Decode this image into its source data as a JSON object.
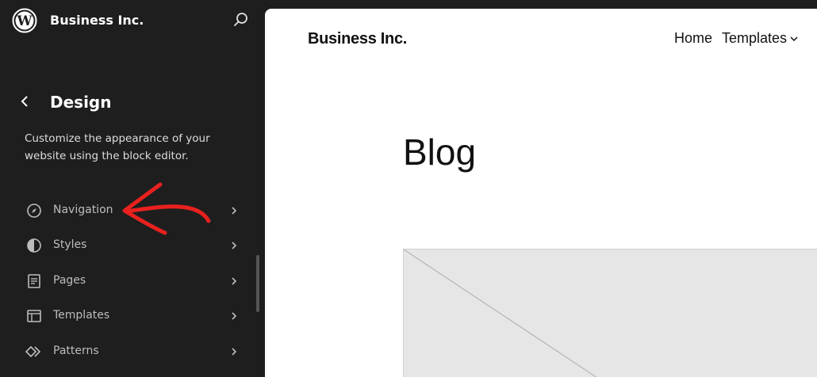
{
  "sidebar": {
    "site_name": "Business Inc.",
    "section_title": "Design",
    "description": "Customize the appearance of your website using the block editor.",
    "items": [
      {
        "label": "Navigation",
        "icon": "navigation-compass-icon"
      },
      {
        "label": "Styles",
        "icon": "styles-half-circle-icon"
      },
      {
        "label": "Pages",
        "icon": "pages-document-icon"
      },
      {
        "label": "Templates",
        "icon": "templates-layout-icon"
      },
      {
        "label": "Patterns",
        "icon": "patterns-diamond-icon"
      }
    ]
  },
  "preview": {
    "site_title": "Business Inc.",
    "nav": [
      "Home",
      "Templates"
    ],
    "heading": "Blog"
  },
  "colors": {
    "sidebar_bg": "#1e1e1e",
    "annotation_red": "#e8211f",
    "placeholder_bg": "#e6e6e6"
  }
}
